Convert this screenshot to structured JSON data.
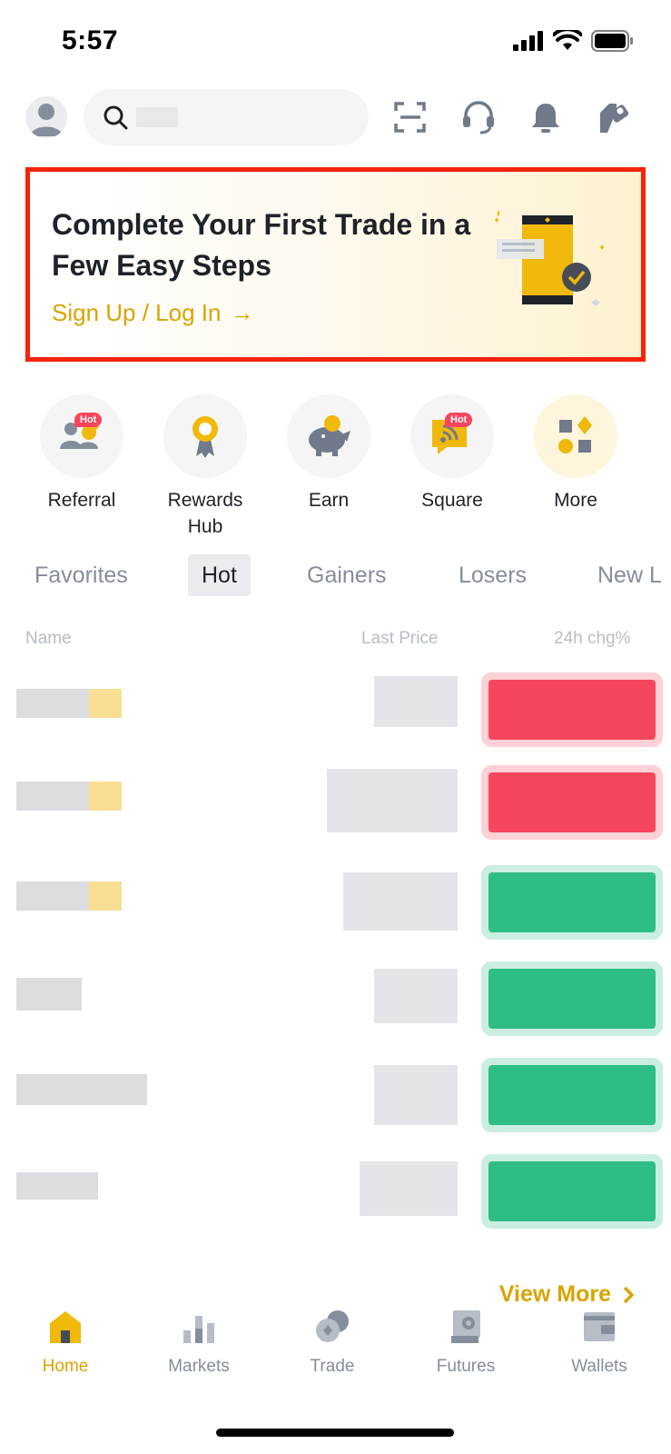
{
  "status_bar": {
    "time": "5:57"
  },
  "banner": {
    "title": "Complete Your First Trade in a Few Easy Steps",
    "cta": "Sign Up / Log In",
    "arrow": "→"
  },
  "quick_actions": [
    {
      "label": "Referral",
      "badge": "Hot",
      "icon": "referral-icon"
    },
    {
      "label": "Rewards Hub",
      "icon": "medal-icon"
    },
    {
      "label": "Earn",
      "icon": "piggy-bank-icon"
    },
    {
      "label": "Square",
      "badge": "Hot",
      "icon": "square-feed-icon"
    },
    {
      "label": "More",
      "icon": "grid-more-icon"
    }
  ],
  "tabs": [
    "Favorites",
    "Hot",
    "Gainers",
    "Losers",
    "New L"
  ],
  "active_tab": "Hot",
  "list_header": {
    "name": "Name",
    "last_price": "Last Price",
    "change": "24h chg%"
  },
  "rows": [
    {
      "change_direction": "down"
    },
    {
      "change_direction": "down"
    },
    {
      "change_direction": "up"
    },
    {
      "change_direction": "up"
    },
    {
      "change_direction": "up"
    },
    {
      "change_direction": "up"
    }
  ],
  "view_more": "View More",
  "bottom_nav": [
    {
      "label": "Home",
      "icon": "home-icon",
      "active": true
    },
    {
      "label": "Markets",
      "icon": "markets-icon"
    },
    {
      "label": "Trade",
      "icon": "trade-icon"
    },
    {
      "label": "Futures",
      "icon": "futures-icon"
    },
    {
      "label": "Wallets",
      "icon": "wallet-icon"
    }
  ],
  "colors": {
    "accent": "#d9a400",
    "banner_border": "#f6230c",
    "down": "#f6465d",
    "up": "#2ebd85",
    "muted": "#848e9c"
  }
}
